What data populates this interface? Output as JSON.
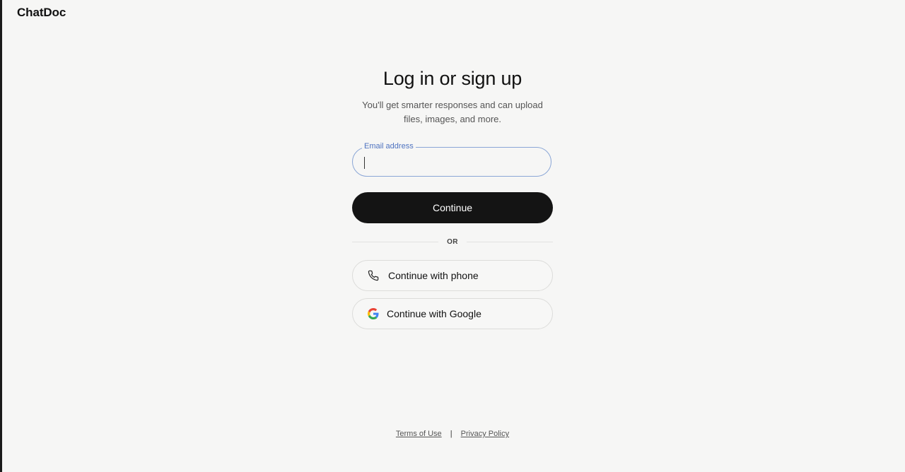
{
  "app": {
    "brand": "ChatDoc"
  },
  "auth": {
    "title": "Log in or sign up",
    "subtitle": "You'll get smarter responses and can upload files, images, and more.",
    "email": {
      "label": "Email address",
      "value": "",
      "placeholder": ""
    },
    "continue_label": "Continue",
    "divider_label": "OR",
    "phone_label": "Continue with phone",
    "google_label": "Continue with Google"
  },
  "footer": {
    "terms_label": "Terms of Use",
    "separator": "|",
    "privacy_label": "Privacy Policy"
  },
  "icons": {
    "phone": "phone-icon",
    "google": "google-icon"
  },
  "colors": {
    "primary_button": "#141414",
    "email_focus_border": "#8aa6d6",
    "email_label": "#4f73c0",
    "background": "#f6f6f5"
  }
}
